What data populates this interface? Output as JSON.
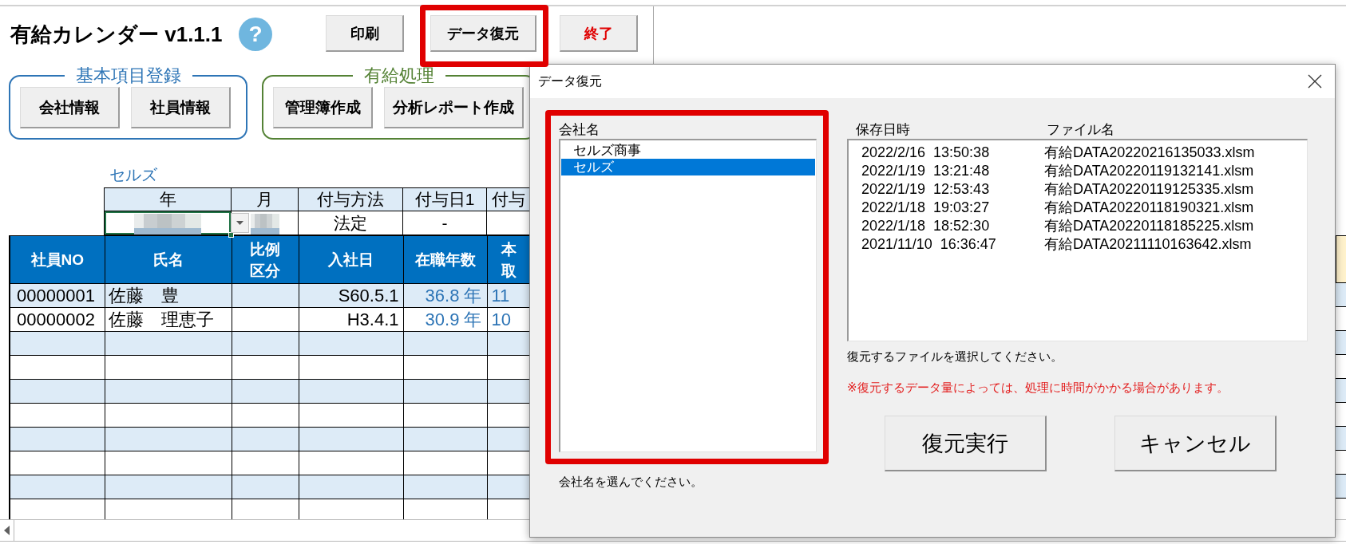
{
  "toolbar": {
    "title": "有給カレンダー v1.1.1",
    "help": "?",
    "buttons": [
      {
        "label": "印刷",
        "kind": "normal",
        "highlighted": false
      },
      {
        "label": "データ復元",
        "kind": "normal",
        "highlighted": true
      },
      {
        "label": "終了",
        "kind": "exit",
        "highlighted": false
      }
    ]
  },
  "groups": [
    {
      "title": "基本項目登録",
      "color": "#2e75b6",
      "buttons": [
        "会社情報",
        "社員情報"
      ]
    },
    {
      "title": "有給処理",
      "color": "#548235",
      "buttons": [
        "管理簿作成",
        "分析レポート作成"
      ]
    }
  ],
  "sheet": {
    "company": "セルズ",
    "settings": {
      "columns": [
        "年",
        "月",
        "付与方法",
        "付与日1",
        "付与"
      ],
      "values": [
        {
          "kind": "blurred",
          "selected": true,
          "dropdown": true
        },
        {
          "kind": "blurred",
          "selected": false,
          "dropdown": false
        },
        {
          "kind": "text",
          "text": "法定",
          "selected": false,
          "dropdown": false
        },
        {
          "kind": "text",
          "text": "-",
          "selected": false,
          "dropdown": false
        }
      ]
    },
    "table": {
      "columns": [
        {
          "label": "社員NO",
          "kind": "id"
        },
        {
          "label": "氏名",
          "kind": "name"
        },
        {
          "label": "比例区分",
          "kind": "ratio"
        },
        {
          "label": "入社日",
          "kind": "date"
        },
        {
          "label": "在職年数",
          "kind": "years"
        },
        {
          "label": "本取",
          "kind": "month"
        }
      ],
      "rows": [
        {
          "id": "00000001",
          "name": "佐藤　豊",
          "date": "S60.5.1",
          "years": "36.8 年",
          "month": "11"
        },
        {
          "id": "00000002",
          "name": "佐藤　理恵子",
          "date": "H3.4.1",
          "years": "30.9 年",
          "month": "10"
        }
      ]
    }
  },
  "dialog": {
    "title": "データ復元",
    "company_list": {
      "label": "会社名",
      "highlighted": true,
      "items": [
        {
          "name": "セルズ商事",
          "selected": false
        },
        {
          "name": "セルズ",
          "selected": true
        }
      ],
      "hint": "会社名を選んでください。"
    },
    "file_list": {
      "columns": [
        "保存日時",
        "ファイル名"
      ],
      "rows": [
        {
          "saved": "2022/2/16  13:50:38",
          "file": "有給DATA20220216135033.xlsm",
          "selected": false
        },
        {
          "saved": "2022/1/19  13:21:48",
          "file": "有給DATA20220119132141.xlsm",
          "selected": false
        },
        {
          "saved": "2022/1/19  12:53:43",
          "file": "有給DATA20220119125335.xlsm",
          "selected": false
        },
        {
          "saved": "2022/1/18  19:03:27",
          "file": "有給DATA20220118190321.xlsm",
          "selected": false
        },
        {
          "saved": "2022/1/18  18:52:30",
          "file": "有給DATA20220118185225.xlsm",
          "selected": false
        },
        {
          "saved": "2021/11/10  16:36:47",
          "file": "有給DATA20211110163642.xlsm",
          "selected": false
        }
      ],
      "hint": "復元するファイルを選択してください。",
      "warning": "※復元するデータ量によっては、処理に時間がかかる場合があります。"
    },
    "buttons": [
      "復元実行",
      "キャンセル"
    ]
  }
}
